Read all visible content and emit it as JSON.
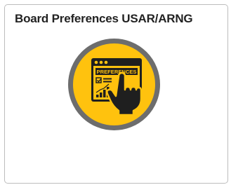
{
  "tile": {
    "title": "Board Preferences USAR/ARNG",
    "icon": {
      "name": "board-preferences-icon",
      "label": "PREFERENCES"
    }
  },
  "colors": {
    "icon_ring": "#6d6d6d",
    "icon_fill": "#ffc20e",
    "icon_dark": "#1f1f1f",
    "tile_border": "#bdbdbd",
    "title_text": "#222222"
  }
}
